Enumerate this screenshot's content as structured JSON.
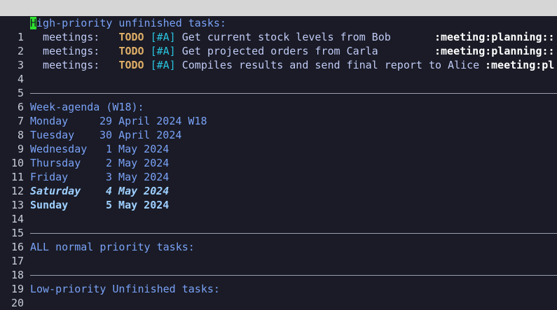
{
  "lines": {
    "l1": {
      "num": "1",
      "first": "H",
      "rest": "igh-priority unfinished tasks:"
    },
    "l2": {
      "num": "2",
      "cat": "  meetings:   ",
      "todo": "TODO",
      "pri": "[#A]",
      "text": "Get current stock levels from Bob",
      "tags": ":meeting:planning::"
    },
    "l3": {
      "num": "3",
      "cat": "  meetings:   ",
      "todo": "TODO",
      "pri": "[#A]",
      "text": "Get projected orders from Carla",
      "tags": ":meeting:planning::"
    },
    "l4": {
      "num": "4",
      "cat": "  meetings:   ",
      "todo": "TODO",
      "pri": "[#A]",
      "text": "Compiles results and send final report to Alice",
      "tags": ":meeting:pl"
    },
    "l5": {
      "num": "5"
    },
    "l6": {
      "num": "6"
    },
    "l7": {
      "num": "7",
      "text": "Week-agenda (W18):"
    },
    "l8": {
      "num": "8",
      "day": "Monday",
      "date": "29 April 2024 W18"
    },
    "l9": {
      "num": "9",
      "day": "Tuesday",
      "date": "30 April 2024"
    },
    "l10": {
      "num": "10",
      "day": "Wednesday",
      "date": "1 May 2024"
    },
    "l11": {
      "num": "11",
      "day": "Thursday",
      "date": "2 May 2024"
    },
    "l12": {
      "num": "12",
      "day": "Friday",
      "date": "3 May 2024"
    },
    "l13": {
      "num": "13",
      "day": "Saturday",
      "date": "4 May 2024"
    },
    "l14": {
      "num": "14",
      "day": "Sunday",
      "date": "5 May 2024"
    },
    "l15": {
      "num": "15"
    },
    "l16": {
      "num": "16"
    },
    "l17": {
      "num": "17",
      "text": "ALL normal priority tasks:"
    },
    "l18": {
      "num": "18"
    },
    "l19": {
      "num": "19"
    },
    "l20": {
      "num": "20",
      "text": "Low-priority Unfinished tasks:"
    }
  },
  "colors": {
    "background": "#1a1b26",
    "heading": "#7aa2f7",
    "todo": "#e0af68",
    "priority": "#2ac3de",
    "weekend": "#9ecfff",
    "cursor": "#2fe02f"
  }
}
